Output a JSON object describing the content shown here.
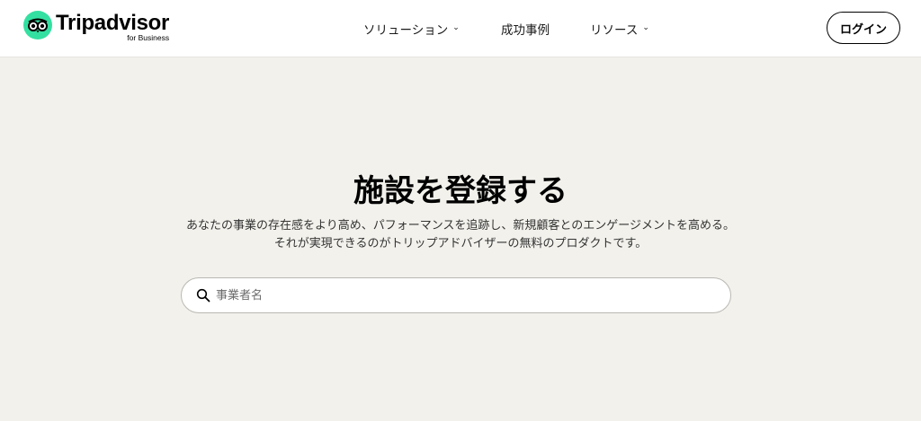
{
  "header": {
    "logo": {
      "name": "Tripadvisor",
      "sub": "for Business",
      "brand_color": "#34e0a1"
    },
    "nav": [
      {
        "label": "ソリューション",
        "has_dropdown": true
      },
      {
        "label": "成功事例",
        "has_dropdown": false
      },
      {
        "label": "リソース",
        "has_dropdown": true
      }
    ],
    "login_label": "ログイン"
  },
  "hero": {
    "title": "施設を登録する",
    "description": "あなたの事業の存在感をより高め、パフォーマンスを追跡し、新規顧客とのエンゲージメントを高める。それが実現できるのがトリップアドバイザーの無料のプロダクトです。"
  },
  "search": {
    "placeholder": "事業者名",
    "value": ""
  },
  "icons": {
    "chevron": "chevron-down-icon",
    "search": "search-icon",
    "logo": "owl-logo-icon"
  },
  "colors": {
    "page_bg": "#f2f1ec",
    "header_bg": "#ffffff"
  }
}
